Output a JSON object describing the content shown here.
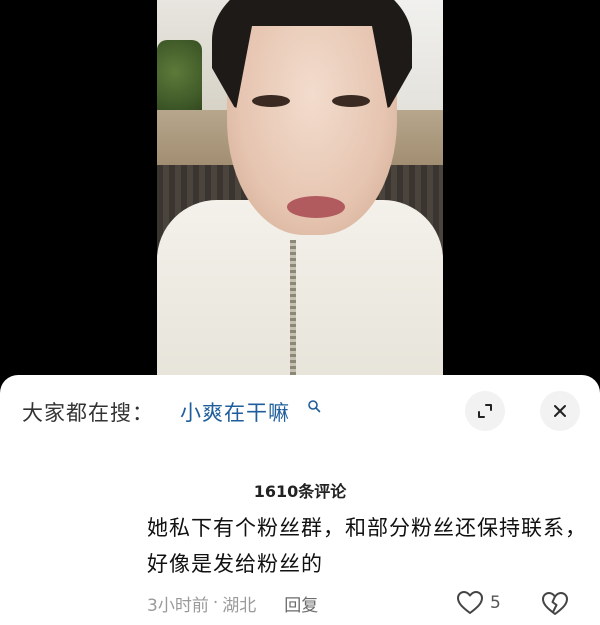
{
  "search": {
    "prefix": "大家都在搜：",
    "term": "小爽在干嘛"
  },
  "icons": {
    "search_mini": "search-icon",
    "expand": "expand-icon",
    "close": "close-icon",
    "like": "heart-icon",
    "dislike": "broken-heart-icon"
  },
  "comments": {
    "count_label": "1610条评论",
    "item": {
      "text": "她私下有个粉丝群，和部分粉丝还保持联系，好像是发给粉丝的",
      "time": "3小时前",
      "separator": "·",
      "location": "湖北",
      "reply_label": "回复",
      "like_count": "5"
    }
  },
  "colors": {
    "search_term": "#1f5e9c",
    "meta": "#9a9a9a",
    "sheet_bg": "#ffffff",
    "button_bg": "#f2f2f2"
  }
}
